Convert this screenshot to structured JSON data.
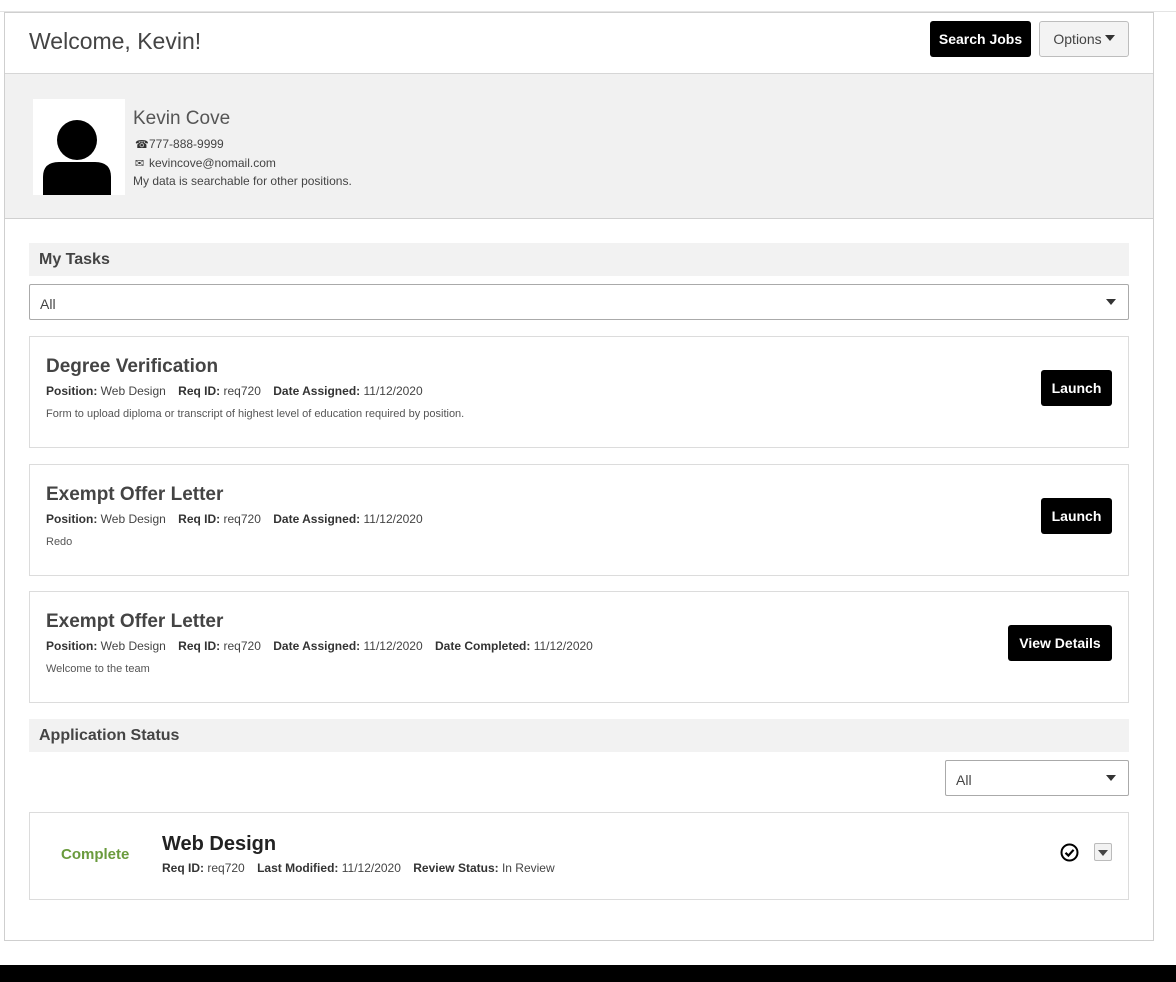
{
  "header": {
    "welcome": "Welcome, Kevin!",
    "search_jobs_label": "Search Jobs",
    "options_label": "Options"
  },
  "profile": {
    "name": "Kevin Cove",
    "phone": "777-888-9999",
    "email": "kevincove@nomail.com",
    "searchable_note": "My data is searchable for other positions."
  },
  "tasks": {
    "heading": "My Tasks",
    "filter_value": "All",
    "items": [
      {
        "title": "Degree Verification",
        "position_label": "Position:",
        "position": "Web Design",
        "req_label": "Req ID:",
        "req_id": "req720",
        "assigned_label": "Date Assigned:",
        "date_assigned": "11/12/2020",
        "description": "Form to upload diploma or transcript of highest level of education required by position.",
        "button": "Launch"
      },
      {
        "title": "Exempt Offer Letter",
        "position_label": "Position:",
        "position": "Web Design",
        "req_label": "Req ID:",
        "req_id": "req720",
        "assigned_label": "Date Assigned:",
        "date_assigned": "11/12/2020",
        "description": "Redo",
        "button": "Launch"
      },
      {
        "title": "Exempt Offer Letter",
        "position_label": "Position:",
        "position": "Web Design",
        "req_label": "Req ID:",
        "req_id": "req720",
        "assigned_label": "Date Assigned:",
        "date_assigned": "11/12/2020",
        "completed_label": "Date Completed:",
        "date_completed": "11/12/2020",
        "description": "Welcome to the team",
        "button": "View Details"
      }
    ]
  },
  "applications": {
    "heading": "Application Status",
    "filter_value": "All",
    "items": [
      {
        "status": "Complete",
        "title": "Web Design",
        "req_label": "Req ID:",
        "req_id": "req720",
        "modified_label": "Last Modified:",
        "last_modified": "11/12/2020",
        "review_label": "Review Status:",
        "review_status": "In Review"
      }
    ]
  },
  "icons": {
    "phone": "phone-icon",
    "email": "envelope-icon",
    "check": "check-circle-icon",
    "avatar": "person-silhouette-icon"
  },
  "colors": {
    "primary_button": "#000000",
    "status_complete": "#6a9b3d",
    "profile_background": "#f1f1f1"
  }
}
